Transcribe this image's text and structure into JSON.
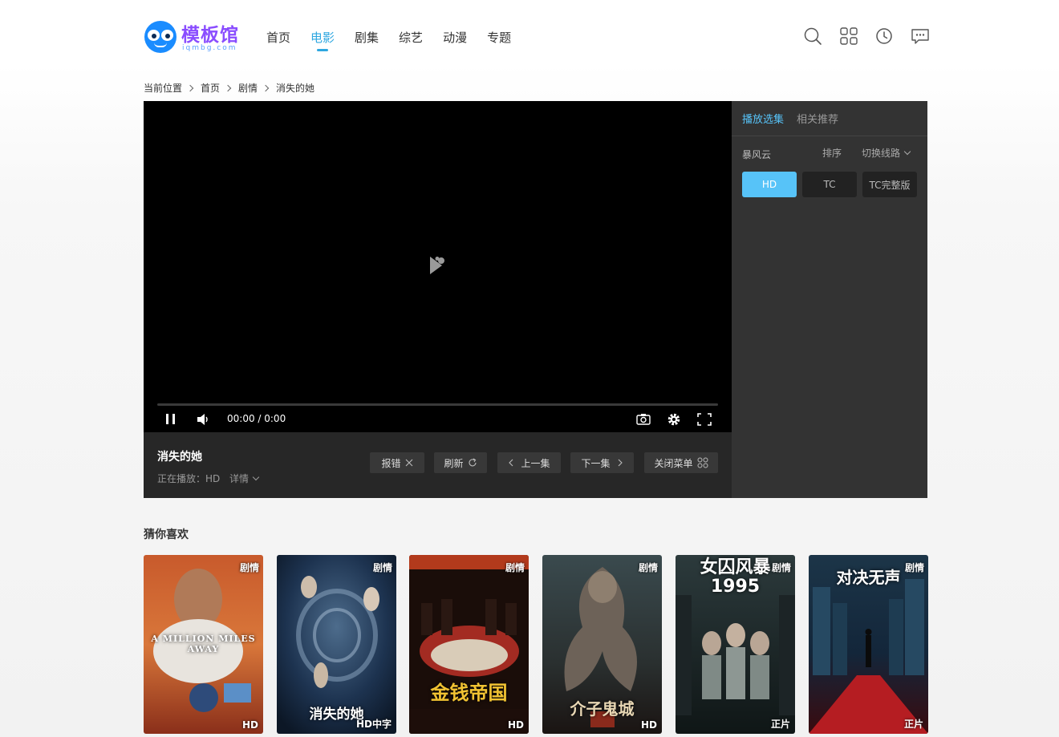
{
  "brand": {
    "name": "模板馆",
    "domain": "iqmbg.com",
    "color": "#8a4dff"
  },
  "nav": [
    {
      "label": "首页",
      "active": false
    },
    {
      "label": "电影",
      "active": true
    },
    {
      "label": "剧集",
      "active": false
    },
    {
      "label": "综艺",
      "active": false
    },
    {
      "label": "动漫",
      "active": false
    },
    {
      "label": "专题",
      "active": false
    }
  ],
  "tools": [
    "search-icon",
    "grid-icon",
    "clock-icon",
    "message-icon"
  ],
  "breadcrumb": {
    "prefix": "当前位置",
    "items": [
      "首页",
      "剧情",
      "消失的她"
    ]
  },
  "player": {
    "time": "00:00 / 0:00",
    "progress": 0
  },
  "info": {
    "title": "消失的她",
    "now_playing": "正在播放：HD",
    "detail_label": "详情",
    "buttons": {
      "report": "报错",
      "refresh": "刷新",
      "prev": "上一集",
      "next": "下一集",
      "close_menu": "关闭菜单"
    }
  },
  "side": {
    "tabs": [
      {
        "label": "播放选集",
        "active": true
      },
      {
        "label": "相关推荐",
        "active": false
      }
    ],
    "source_name": "暴风云",
    "sort_label": "排序",
    "switch_label": "切换线路",
    "episodes": [
      {
        "label": "HD",
        "active": true
      },
      {
        "label": "TC",
        "active": false
      },
      {
        "label": "TC完整版",
        "active": false
      }
    ],
    "accent": "#57c3f8"
  },
  "recommend": {
    "title": "猜你喜欢",
    "items": [
      {
        "tag": "剧情",
        "quality": "HD",
        "poster_text": "A MILLION MILES AWAY"
      },
      {
        "tag": "剧情",
        "quality": "HD中字",
        "poster_text": "消失的她"
      },
      {
        "tag": "剧情",
        "quality": "HD",
        "poster_text": "金钱帝国"
      },
      {
        "tag": "剧情",
        "quality": "HD",
        "poster_text": "介子鬼城"
      },
      {
        "tag": "剧情",
        "quality": "正片",
        "poster_text": "女囚风暴1995"
      },
      {
        "tag": "剧情",
        "quality": "正片",
        "poster_text": "对决无声"
      }
    ]
  }
}
